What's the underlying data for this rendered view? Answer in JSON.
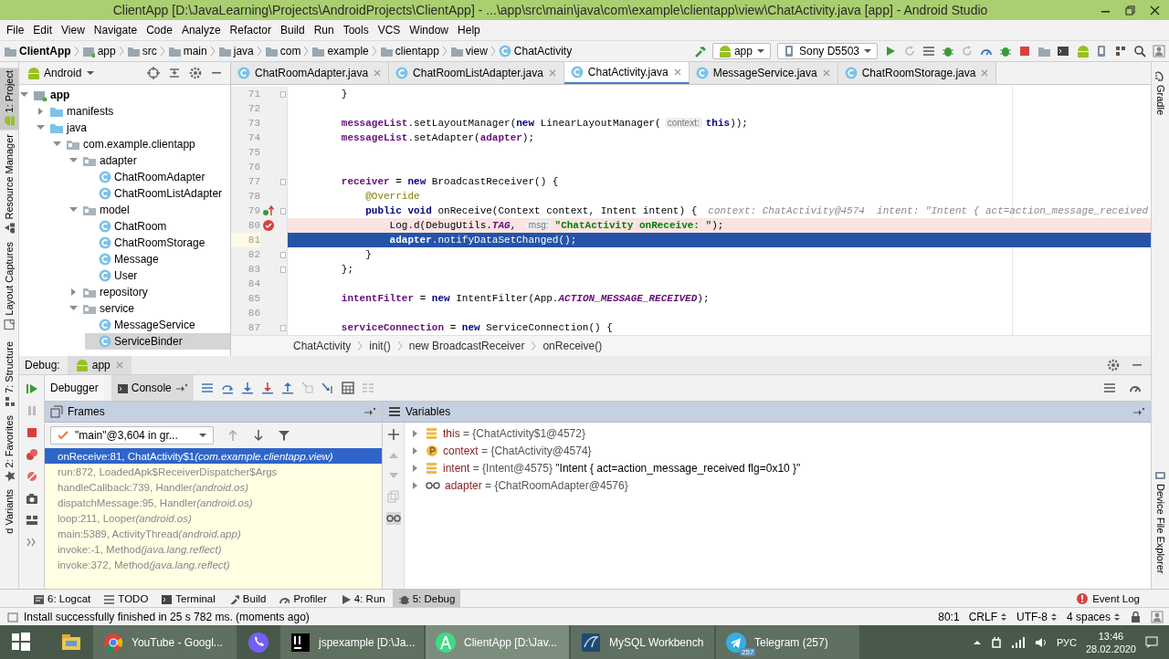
{
  "window": {
    "title": "ClientApp [D:\\JavaLearning\\Projects\\AndroidProjects\\ClientApp] - ...\\app\\src\\main\\java\\com\\example\\clientapp\\view\\ChatActivity.java [app] - Android Studio"
  },
  "menu": [
    "File",
    "Edit",
    "View",
    "Navigate",
    "Code",
    "Analyze",
    "Refactor",
    "Build",
    "Run",
    "Tools",
    "VCS",
    "Window",
    "Help"
  ],
  "breadcrumb": [
    {
      "label": "ClientApp",
      "kind": "project"
    },
    {
      "label": "app",
      "kind": "module"
    },
    {
      "label": "src",
      "kind": "folder"
    },
    {
      "label": "main",
      "kind": "folder"
    },
    {
      "label": "java",
      "kind": "folder"
    },
    {
      "label": "com",
      "kind": "folder"
    },
    {
      "label": "example",
      "kind": "folder"
    },
    {
      "label": "clientapp",
      "kind": "folder"
    },
    {
      "label": "view",
      "kind": "folder"
    },
    {
      "label": "ChatActivity",
      "kind": "class"
    }
  ],
  "run_config": {
    "module": "app",
    "device": "Sony D5503"
  },
  "left_tool_tabs": [
    {
      "label": "1: Project",
      "selected": true,
      "kind": "project"
    },
    {
      "label": "Resource Manager",
      "selected": false,
      "kind": "resources"
    },
    {
      "label": "Layout Captures",
      "selected": false,
      "kind": "captures"
    },
    {
      "label": "7: Structure",
      "selected": false,
      "kind": "structure"
    },
    {
      "label": "2: Favorites",
      "selected": false,
      "kind": "favorites"
    },
    {
      "label": "d Variants",
      "selected": false,
      "kind": "variants"
    }
  ],
  "right_tool_tabs": [
    {
      "label": "Gradle",
      "kind": "gradle"
    },
    {
      "label": "Device File Explorer",
      "kind": "device"
    }
  ],
  "project_panel": {
    "view": "Android",
    "tree": [
      {
        "label": "app",
        "kind": "module",
        "expanded": true,
        "selected": false,
        "children": [
          {
            "label": "manifests",
            "kind": "source",
            "expanded": false,
            "selected": false
          },
          {
            "label": "java",
            "kind": "source",
            "expanded": true,
            "selected": false,
            "children": [
              {
                "label": "com.example.clientapp",
                "kind": "package",
                "expanded": true,
                "selected": false,
                "children": [
                  {
                    "label": "adapter",
                    "kind": "package",
                    "expanded": true,
                    "selected": false,
                    "children": [
                      {
                        "label": "ChatRoomAdapter",
                        "kind": "class",
                        "selected": false
                      },
                      {
                        "label": "ChatRoomListAdapter",
                        "kind": "class",
                        "selected": false
                      }
                    ]
                  },
                  {
                    "label": "model",
                    "kind": "package",
                    "expanded": true,
                    "selected": false,
                    "children": [
                      {
                        "label": "ChatRoom",
                        "kind": "class",
                        "selected": false
                      },
                      {
                        "label": "ChatRoomStorage",
                        "kind": "class",
                        "selected": false
                      },
                      {
                        "label": "Message",
                        "kind": "class",
                        "selected": false
                      },
                      {
                        "label": "User",
                        "kind": "class",
                        "selected": false
                      }
                    ]
                  },
                  {
                    "label": "repository",
                    "kind": "package",
                    "expanded": false,
                    "selected": false
                  },
                  {
                    "label": "service",
                    "kind": "package",
                    "expanded": true,
                    "selected": false,
                    "children": [
                      {
                        "label": "MessageService",
                        "kind": "class",
                        "selected": false
                      },
                      {
                        "label": "ServiceBinder",
                        "kind": "class",
                        "selected": true
                      }
                    ]
                  }
                ]
              }
            ]
          }
        ]
      }
    ]
  },
  "editor": {
    "tabs": [
      {
        "label": "ChatRoomAdapter.java",
        "selected": false
      },
      {
        "label": "ChatRoomListAdapter.java",
        "selected": false
      },
      {
        "label": "ChatActivity.java",
        "selected": true
      },
      {
        "label": "MessageService.java",
        "selected": false
      },
      {
        "label": "ChatRoomStorage.java",
        "selected": false
      }
    ],
    "lines": [
      {
        "number": "71",
        "kind": "normal",
        "fold": true,
        "segments": [
          {
            "kind": "plain",
            "text": "        }"
          }
        ]
      },
      {
        "number": "72",
        "kind": "normal",
        "fold": false
      },
      {
        "number": "73",
        "kind": "normal",
        "fold": false,
        "segments": [
          {
            "kind": "field",
            "text": "        messageList"
          },
          {
            "kind": "plain",
            "text": ".setLayoutManager("
          },
          {
            "kind": "kw",
            "text": "new"
          },
          {
            "kind": "plain",
            "text": " LinearLayoutManager("
          },
          {
            "kind": "hint",
            "text": "context:"
          },
          {
            "kind": "kw",
            "text": "this"
          },
          {
            "kind": "plain",
            "text": "));"
          }
        ]
      },
      {
        "number": "74",
        "kind": "normal",
        "fold": false,
        "segments": [
          {
            "kind": "field",
            "text": "        messageList"
          },
          {
            "kind": "plain",
            "text": ".setAdapter("
          },
          {
            "kind": "field",
            "text": "adapter"
          },
          {
            "kind": "plain",
            "text": ");"
          }
        ]
      },
      {
        "number": "75",
        "kind": "normal",
        "fold": false
      },
      {
        "number": "76",
        "kind": "normal",
        "fold": false
      },
      {
        "number": "77",
        "kind": "normal",
        "fold": true,
        "segments": [
          {
            "kind": "field",
            "text": "        receiver"
          },
          {
            "kind": "plain",
            "text": " = "
          },
          {
            "kind": "kw",
            "text": "new"
          },
          {
            "kind": "plain",
            "text": " BroadcastReceiver() {"
          }
        ]
      },
      {
        "number": "78",
        "kind": "normal",
        "fold": false,
        "segments": [
          {
            "kind": "annotation",
            "text": "            @Override"
          }
        ]
      },
      {
        "number": "79",
        "kind": "normal",
        "fold": true,
        "gutter_mark": {
          "kind": "override"
        },
        "segments": [
          {
            "kind": "kw",
            "text": "            public void"
          },
          {
            "kind": "plain",
            "text": " onReceive(Context context, Intent intent) {"
          },
          {
            "kind": "inline",
            "text": "context: ChatActivity@4574  intent: \"Intent { act=action_message_received"
          }
        ]
      },
      {
        "number": "80",
        "kind": "breakpoint",
        "fold": false,
        "gutter_mark": {
          "kind": "breakpoint"
        },
        "segments": [
          {
            "kind": "plain",
            "text": "                Log.d(DebugUtils."
          },
          {
            "kind": "static",
            "text": "TAG"
          },
          {
            "kind": "plain",
            "text": ", "
          },
          {
            "kind": "hint",
            "text": "msg:"
          },
          {
            "kind": "string",
            "text": "\"ChatActivity onReceive: \""
          },
          {
            "kind": "plain",
            "text": ");"
          }
        ]
      },
      {
        "number": "81",
        "kind": "execution",
        "fold": false,
        "segments": [
          {
            "kind": "field",
            "text": "                adapter"
          },
          {
            "kind": "plain",
            "text": ".notifyDataSetChanged();"
          }
        ]
      },
      {
        "number": "82",
        "kind": "normal",
        "fold": true,
        "segments": [
          {
            "kind": "plain",
            "text": "            }"
          }
        ]
      },
      {
        "number": "83",
        "kind": "normal",
        "fold": true,
        "segments": [
          {
            "kind": "plain",
            "text": "        };"
          }
        ]
      },
      {
        "number": "84",
        "kind": "normal",
        "fold": false
      },
      {
        "number": "85",
        "kind": "normal",
        "fold": false,
        "segments": [
          {
            "kind": "field",
            "text": "        intentFilter"
          },
          {
            "kind": "plain",
            "text": " = "
          },
          {
            "kind": "kw",
            "text": "new"
          },
          {
            "kind": "plain",
            "text": " IntentFilter(App."
          },
          {
            "kind": "static",
            "text": "ACTION_MESSAGE_RECEIVED"
          },
          {
            "kind": "plain",
            "text": ");"
          }
        ]
      },
      {
        "number": "86",
        "kind": "normal",
        "fold": false
      },
      {
        "number": "87",
        "kind": "normal",
        "fold": true,
        "segments": [
          {
            "kind": "field",
            "text": "        serviceConnection"
          },
          {
            "kind": "plain",
            "text": " = "
          },
          {
            "kind": "kw",
            "text": "new"
          },
          {
            "kind": "plain",
            "text": " ServiceConnection() {"
          }
        ]
      }
    ],
    "breadcrumb": [
      "ChatActivity",
      "init()",
      "new BroadcastReceiver",
      "onReceive()"
    ]
  },
  "debug": {
    "title": "Debug:",
    "session": "app",
    "tabs": [
      {
        "label": "Debugger",
        "selected": true
      },
      {
        "label": "Console",
        "selected": false
      }
    ],
    "frames_title": "Frames",
    "thread": "\"main\"@3,604 in gr...",
    "frames": [
      {
        "method": "onReceive:81, ChatActivity$1",
        "package": "(com.example.clientapp.view)",
        "selected": true
      },
      {
        "method": "run:872, LoadedApk$ReceiverDispatcher$Args",
        "selected": false
      },
      {
        "method": "handleCallback:739, Handler",
        "package": "(android.os)",
        "selected": false
      },
      {
        "method": "dispatchMessage:95, Handler",
        "package": "(android.os)",
        "selected": false
      },
      {
        "method": "loop:211, Looper",
        "package": "(android.os)",
        "selected": false
      },
      {
        "method": "main:5389, ActivityThread",
        "package": "(android.app)",
        "selected": false
      },
      {
        "method": "invoke:-1, Method",
        "package": "(java.lang.reflect)",
        "selected": false
      },
      {
        "method": "invoke:372, Method",
        "package": "(java.lang.reflect)",
        "selected": false
      }
    ],
    "variables_title": "Variables",
    "variables": [
      {
        "name": "this",
        "value": "= {ChatActivity$1@4572}",
        "kind": "field"
      },
      {
        "name": "context",
        "value": "= {ChatActivity@4574}",
        "kind": "param"
      },
      {
        "name": "intent",
        "value": "= {Intent@4575}",
        "detail": "\"Intent { act=action_message_received flg=0x10 }\"",
        "kind": "field"
      },
      {
        "name": "adapter",
        "value": "= {ChatRoomAdapter@4576}",
        "kind": "watch"
      }
    ]
  },
  "bottom_tabs": [
    {
      "label": "6: Logcat",
      "kind": "logcat",
      "selected": false
    },
    {
      "label": "TODO",
      "kind": "todo",
      "selected": false
    },
    {
      "label": "Terminal",
      "kind": "terminal",
      "selected": false
    },
    {
      "label": "Build",
      "kind": "build",
      "selected": false
    },
    {
      "label": "Profiler",
      "kind": "profiler",
      "selected": false
    },
    {
      "label": "4: Run",
      "kind": "run",
      "selected": false
    },
    {
      "label": "5: Debug",
      "kind": "debug",
      "selected": true
    }
  ],
  "event_log": "Event Log",
  "status": {
    "message": "Install successfully finished in 25 s 782 ms. (moments ago)",
    "position": "80:1",
    "line_separator": "CRLF",
    "encoding": "UTF-8",
    "indent": "4 spaces"
  },
  "taskbar": {
    "items": [
      {
        "kind": "explorer",
        "active": false
      },
      {
        "kind": "chrome",
        "label": "YouTube - Googl...",
        "active": false
      },
      {
        "kind": "viber",
        "active": false
      },
      {
        "kind": "intellij",
        "label": "jspexample [D:\\Ja...",
        "active": false
      },
      {
        "kind": "android",
        "label": "ClientApp [D:\\Jav...",
        "active": true
      },
      {
        "kind": "mysql",
        "label": "MySQL Workbench",
        "active": false
      },
      {
        "kind": "telegram",
        "label": "Telegram (257)",
        "badge": "257",
        "active": false
      }
    ],
    "language": "РУС",
    "time": "13:46",
    "date": "28.02.2020"
  }
}
